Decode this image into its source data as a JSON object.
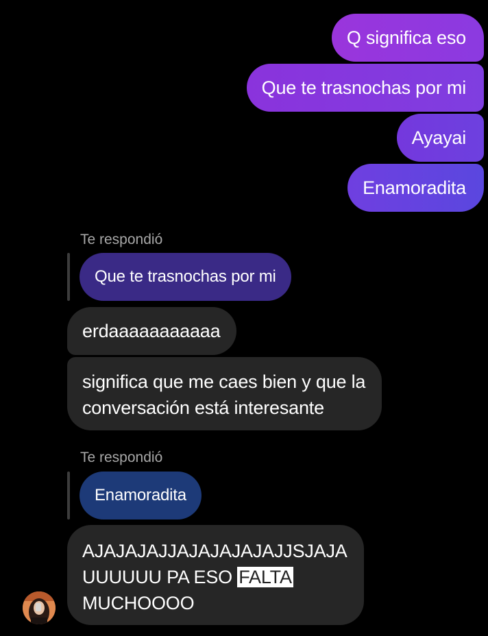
{
  "colors": {
    "background": "#000000",
    "received_bubble": "#262626",
    "reply_label": "#a8a8a8",
    "quoted_purple": "#3a2a86",
    "quoted_blue": "#1d3a78"
  },
  "sent_messages": [
    {
      "text": "Q significa eso"
    },
    {
      "text": "Que te trasnochas por mi"
    },
    {
      "text": "Ayayai"
    },
    {
      "text": "Enamoradita"
    }
  ],
  "replies": [
    {
      "label": "Te respondió",
      "quoted": "Que te trasnochas por mi",
      "messages": [
        {
          "text": "erdaaaaaaaaaaa"
        },
        {
          "line1": "significa que me caes bien y que la",
          "line2": "conversación está interesante"
        }
      ]
    },
    {
      "label": "Te respondió",
      "quoted": "Enamoradita",
      "messages": [
        {
          "line1": "AJAJAJAJJAJAJAJAJAJJSJAJA",
          "line2_before": "UUUUUU PA ESO ",
          "line2_highlight": "FALTA",
          "line3": "MUCHOOOO"
        }
      ]
    }
  ],
  "avatar": {
    "icon": "contact-avatar"
  }
}
